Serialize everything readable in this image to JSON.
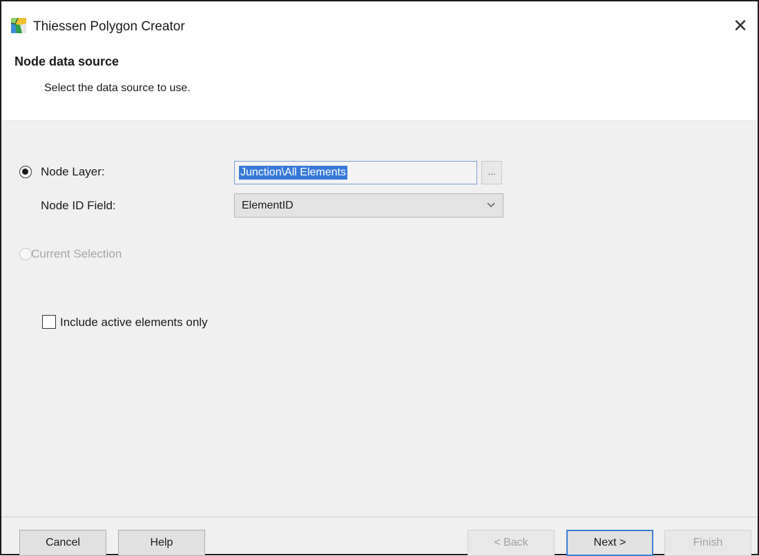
{
  "window": {
    "title": "Thiessen Polygon Creator",
    "close_symbol": "✕"
  },
  "header": {
    "title": "Node data source",
    "subtitle": "Select the data source to use."
  },
  "options": {
    "node_layer": {
      "label": "Node Layer:",
      "selected": true,
      "value": "Junction\\All Elements",
      "browse_label": "..."
    },
    "node_id_field": {
      "label": "Node ID Field:",
      "selected_value": "ElementID"
    },
    "current_selection": {
      "label": "Current Selection",
      "selected": false,
      "enabled": false
    },
    "include_active": {
      "label": "Include active elements only",
      "checked": false
    }
  },
  "buttons": {
    "cancel": "Cancel",
    "help": "Help",
    "back": "< Back",
    "next": "Next >",
    "finish": "Finish"
  },
  "colors": {
    "selection_highlight": "#3779d9",
    "focus_border": "#3b7fd8",
    "dialog_background": "#f0f0f0"
  }
}
